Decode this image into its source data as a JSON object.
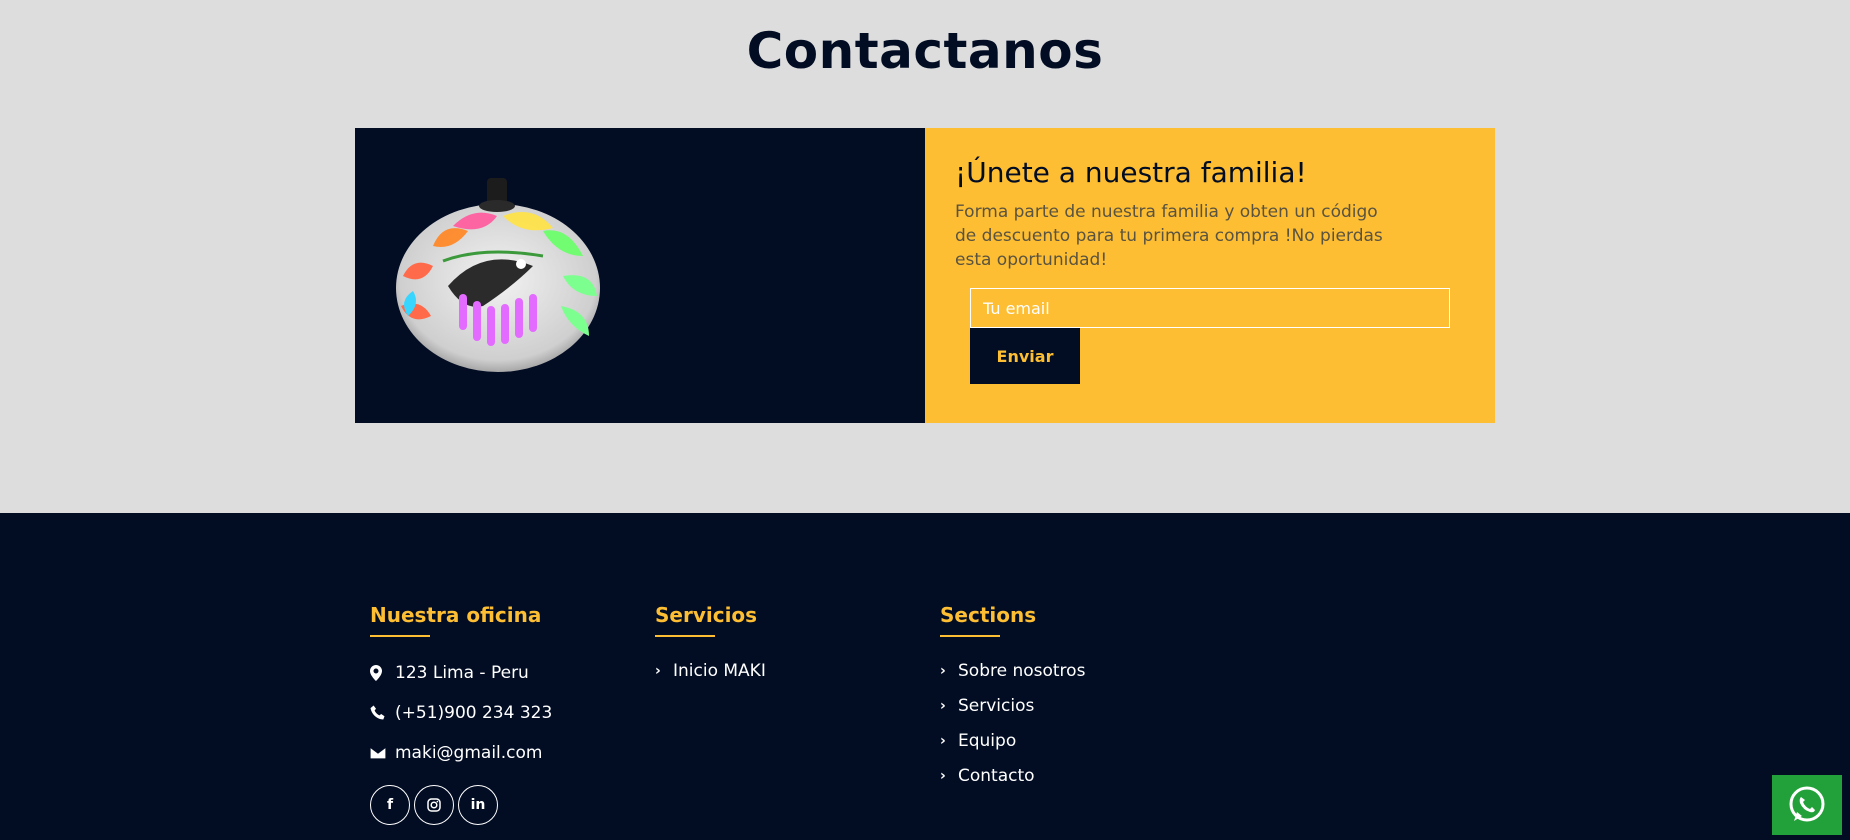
{
  "page_title": "Contactanos",
  "promo": {
    "heading": "¡Únete a nuestra familia!",
    "text": "Forma parte de nuestra familia y obten un código de descuento para tu primera compra !No pierdas esta oportunidad!",
    "email_placeholder": "Tu email",
    "send_label": "Enviar",
    "image_alt": "gourd-image"
  },
  "footer": {
    "office": {
      "title": "Nuestra oficina",
      "address": "123 Lima - Peru",
      "phone": "(+51)900 234 323",
      "email": "maki@gmail.com",
      "social": [
        {
          "icon": "facebook-icon",
          "glyph": "f"
        },
        {
          "icon": "instagram-icon",
          "glyph": ""
        },
        {
          "icon": "linkedin-icon",
          "glyph": "in"
        }
      ]
    },
    "services": {
      "title": "Servicios",
      "links": [
        "Inicio MAKI"
      ]
    },
    "sections": {
      "title": "Sections",
      "links": [
        "Sobre nosotros",
        "Servicios",
        "Equipo",
        "Contacto"
      ]
    }
  },
  "whatsapp": {
    "icon": "whatsapp-icon"
  },
  "colors": {
    "navy": "#020d24",
    "accent": "#fdbe33",
    "background": "#dddddd",
    "whatsapp_green": "#22a13a"
  }
}
